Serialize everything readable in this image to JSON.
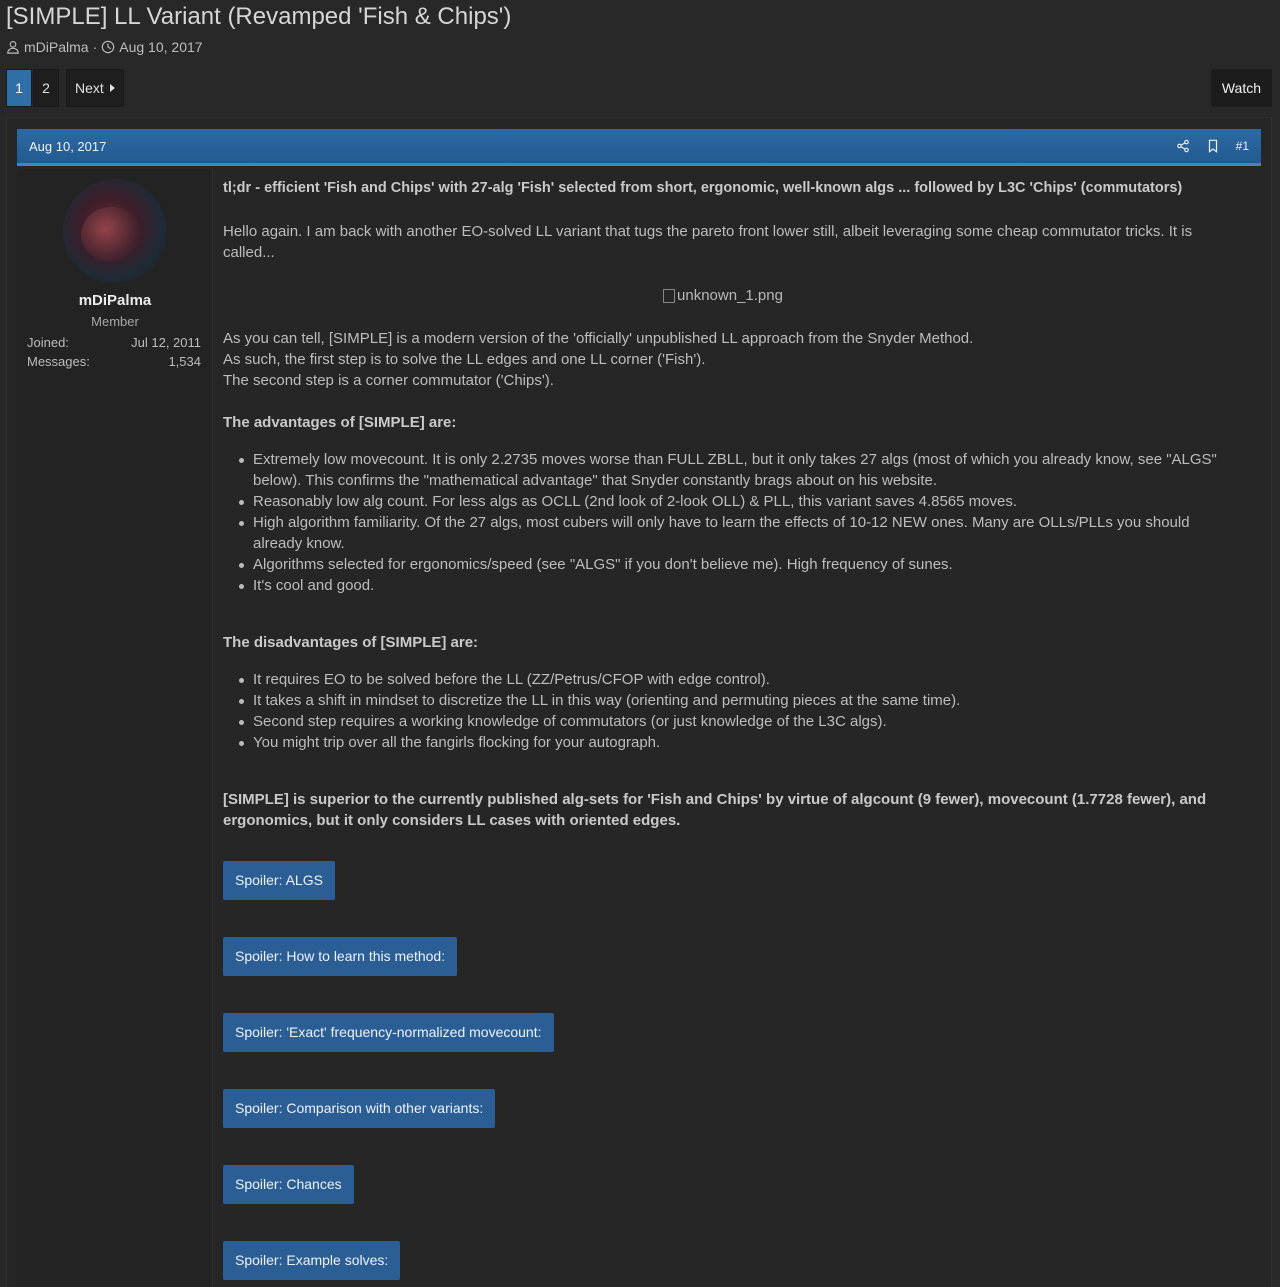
{
  "thread": {
    "title": "[SIMPLE] LL Variant (Revamped 'Fish & Chips')",
    "author": "mDiPalma",
    "sep": "·",
    "date": "Aug 10, 2017"
  },
  "pager": {
    "pages": [
      "1",
      "2"
    ],
    "next_label": "Next",
    "watch_label": "Watch"
  },
  "post": {
    "date": "Aug 10, 2017",
    "number": "#1",
    "user": {
      "name": "mDiPalma",
      "title": "Member",
      "joined_label": "Joined:",
      "joined_value": "Jul 12, 2011",
      "messages_label": "Messages:",
      "messages_value": "1,534"
    },
    "tldr": "tl;dr - efficient 'Fish and Chips' with 27-alg 'Fish' selected from short, ergonomic, well-known algs ... followed by L3C 'Chips' (commutators)",
    "intro": "Hello again. I am back with another EO-solved LL variant that tugs the pareto front lower still, albeit leveraging some cheap commutator tricks. It is called...",
    "image_alt": "unknown_1.png",
    "line1": "As you can tell, [SIMPLE] is a modern version of the 'officially' unpublished LL approach from the Snyder Method.",
    "line2": "As such, the first step is to solve the LL edges and one LL corner ('Fish').",
    "line3": "The second step is a corner commutator ('Chips').",
    "adv_heading": "The advantages of [SIMPLE] are:",
    "advantages": [
      "Extremely low movecount. It is only 2.2735 moves worse than FULL ZBLL, but it only takes 27 algs (most of which you already know, see \"ALGS\" below). This confirms the \"mathematical advantage\" that Snyder constantly brags about on his website.",
      "Reasonably low alg count. For less algs as OCLL (2nd look of 2-look OLL) & PLL, this variant saves 4.8565 moves.",
      "High algorithm familiarity. Of the 27 algs, most cubers will only have to learn the effects of 10-12 NEW ones. Many are OLLs/PLLs you should already know.",
      "Algorithms selected for ergonomics/speed (see \"ALGS\" if you don't believe me). High frequency of sunes.",
      "It's cool and good."
    ],
    "dis_heading": "The disadvantages of [SIMPLE] are:",
    "disadvantages": [
      "It requires EO to be solved before the LL (ZZ/Petrus/CFOP with edge control).",
      "It takes a shift in mindset to discretize the LL in this way (orienting and permuting pieces at the same time).",
      "Second step requires a working knowledge of commutators (or just knowledge of the L3C algs).",
      "You might trip over all the fangirls flocking for your autograph."
    ],
    "summary": "[SIMPLE] is superior to the currently published alg-sets for 'Fish and Chips' by virtue of algcount (9 fewer), movecount (1.7728 fewer), and ergonomics, but it only considers LL cases with oriented edges.",
    "spoilers": [
      "Spoiler: ALGS",
      "Spoiler: How to learn this method:",
      "Spoiler: 'Exact' frequency-normalized movecount:",
      "Spoiler: Comparison with other variants:",
      "Spoiler: Chances",
      "Spoiler: Example solves:"
    ]
  }
}
